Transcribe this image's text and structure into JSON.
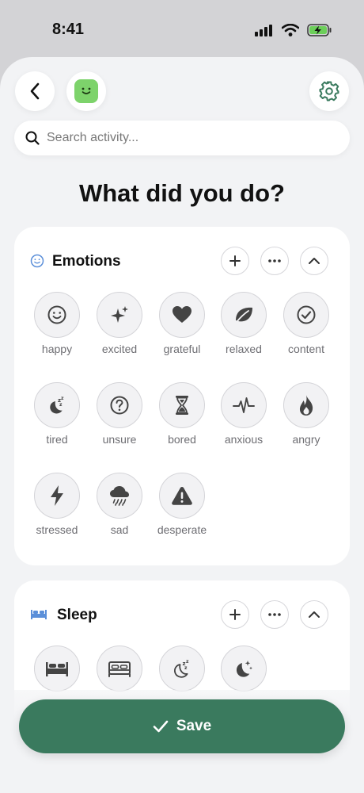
{
  "status_bar": {
    "time": "8:41",
    "icons": [
      "signal-icon",
      "wifi-icon",
      "battery-charging-icon"
    ],
    "battery_color": "#6ccf5a"
  },
  "header": {
    "back_icon": "chevron-left-icon",
    "mood_icon": "smiley-square-icon",
    "mood_color": "#7dd36b",
    "settings_icon": "gear-icon",
    "accent_color": "#3a7a5e"
  },
  "search": {
    "placeholder": "Search activity...",
    "value": ""
  },
  "page_title": "What did you do?",
  "sections": {
    "emotions": {
      "title": "Emotions",
      "icon": "smiley-outline-icon",
      "items": [
        {
          "label": "happy",
          "icon": "happy-face-icon"
        },
        {
          "label": "excited",
          "icon": "sparkles-icon"
        },
        {
          "label": "grateful",
          "icon": "heart-icon"
        },
        {
          "label": "relaxed",
          "icon": "leaf-icon"
        },
        {
          "label": "content",
          "icon": "check-circle-icon"
        },
        {
          "label": "tired",
          "icon": "moon-zzz-icon"
        },
        {
          "label": "unsure",
          "icon": "question-circle-icon"
        },
        {
          "label": "bored",
          "icon": "hourglass-icon"
        },
        {
          "label": "anxious",
          "icon": "pulse-icon"
        },
        {
          "label": "angry",
          "icon": "flame-icon"
        },
        {
          "label": "stressed",
          "icon": "lightning-icon"
        },
        {
          "label": "sad",
          "icon": "rain-cloud-icon"
        },
        {
          "label": "desperate",
          "icon": "warning-triangle-icon"
        }
      ]
    },
    "sleep": {
      "title": "Sleep",
      "icon": "bed-icon",
      "icon_color": "#5b8fd9",
      "items": [
        {
          "label": "",
          "icon": "bed-filled-icon"
        },
        {
          "label": "",
          "icon": "bed-outline-icon"
        },
        {
          "label": "",
          "icon": "moon-zzz-outline-icon"
        },
        {
          "label": "",
          "icon": "moon-stars-icon"
        }
      ]
    }
  },
  "save_button": {
    "label": "Save",
    "icon": "checkmark-icon"
  }
}
